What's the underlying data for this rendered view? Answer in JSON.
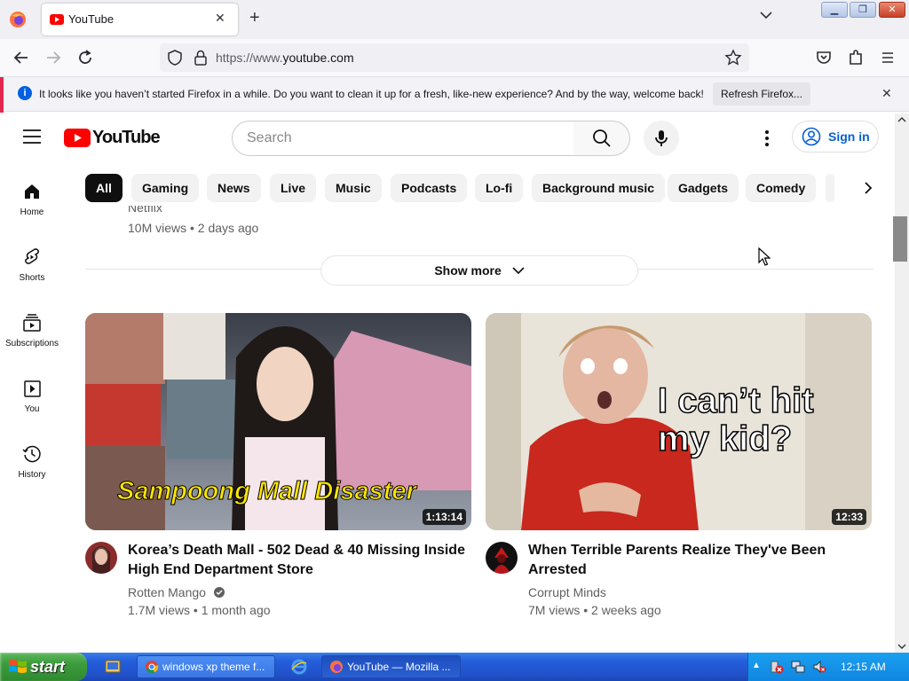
{
  "browser": {
    "tab_title": "YouTube",
    "url_prefix": "https://www.",
    "url_domain": "youtube.com",
    "notification": "It looks like you haven’t started Firefox in a while. Do you want to clean it up for a fresh, like-new experience? And by the way, welcome back!",
    "refresh_label": "Refresh Firefox..."
  },
  "youtube": {
    "logo_text": "YouTube",
    "search_placeholder": "Search",
    "signin_label": "Sign in",
    "chips": [
      "All",
      "Gaming",
      "News",
      "Live",
      "Music",
      "Podcasts",
      "Lo-fi",
      "Background music",
      "Gadgets",
      "Comedy"
    ],
    "sidebar": [
      {
        "label": "Home",
        "icon": "home-icon"
      },
      {
        "label": "Shorts",
        "icon": "shorts-icon"
      },
      {
        "label": "Subscriptions",
        "icon": "subscriptions-icon"
      },
      {
        "label": "You",
        "icon": "you-icon"
      },
      {
        "label": "History",
        "icon": "history-icon"
      }
    ],
    "prev_channel_partial": "Netflix",
    "prev_meta": "10M views • 2 days ago",
    "show_more": "Show more",
    "videos": [
      {
        "thumb_text": "Sampoong Mall Disaster",
        "duration": "1:13:14",
        "title": "Korea’s Death Mall - 502 Dead & 40 Missing Inside High End Department Store",
        "channel": "Rotten Mango",
        "meta": "1.7M views • 1 month ago"
      },
      {
        "thumb_text_line1": "I can’t hit",
        "thumb_text_line2": "my kid?",
        "duration": "12:33",
        "title": "When Terrible Parents Realize They've Been Arrested",
        "channel": "Corrupt Minds",
        "meta": "7M views • 2 weeks ago"
      }
    ]
  },
  "taskbar": {
    "start": "start",
    "tasks": [
      "windows xp theme f...",
      "YouTube — Mozilla ..."
    ],
    "clock": "12:15 AM"
  },
  "colors": {
    "youtube_red": "#ff0000",
    "link_blue": "#065fd4",
    "xp_blue": "#245edb",
    "xp_green": "#3c9b3c"
  }
}
